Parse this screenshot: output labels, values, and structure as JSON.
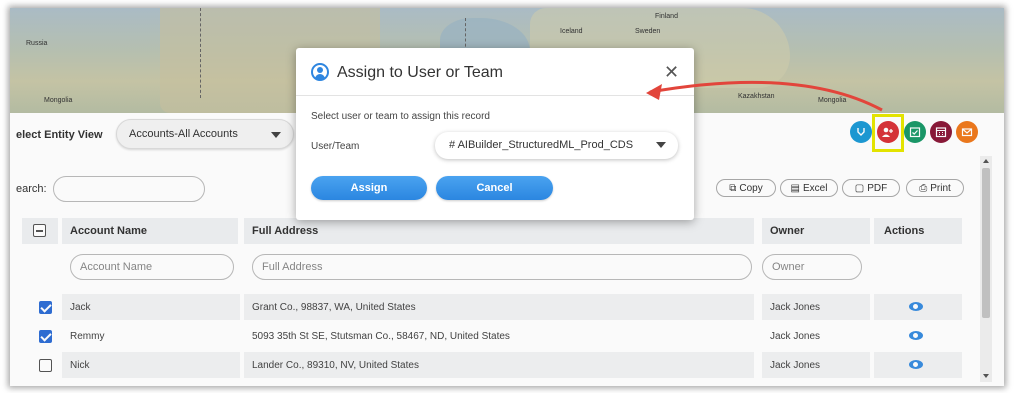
{
  "map": {
    "labels": [
      "Russia",
      "Mongolia",
      "Finland",
      "Iceland",
      "Sweden",
      "Kazakhstan",
      "Mongolia"
    ]
  },
  "toolbar": {
    "entity_view_label": "elect Entity View",
    "entity_view_value": "Accounts-All Accounts"
  },
  "icons": {
    "buttons": [
      {
        "name": "filter-icon",
        "color": "#1d9bd6"
      },
      {
        "name": "assign-user-icon",
        "color": "#d9343a"
      },
      {
        "name": "calendar-check-icon",
        "color": "#1b9a6a"
      },
      {
        "name": "calendar-icon",
        "color": "#8b1a3a"
      },
      {
        "name": "email-icon",
        "color": "#ef7a1d"
      }
    ],
    "highlight_color": "#e8e800",
    "arrow_color": "#e2453b"
  },
  "search": {
    "label": "earch:"
  },
  "export": {
    "copy": "Copy",
    "excel": "Excel",
    "pdf": "PDF",
    "print": "Print"
  },
  "table": {
    "headers": {
      "account_name": "Account Name",
      "full_address": "Full Address",
      "owner": "Owner",
      "actions": "Actions"
    },
    "filters": {
      "account_name": "Account Name",
      "full_address": "Full Address",
      "owner": "Owner"
    },
    "rows": [
      {
        "checked": true,
        "account_name": "Jack",
        "full_address": "Grant Co., 98837, WA, United States",
        "owner": "Jack Jones"
      },
      {
        "checked": true,
        "account_name": "Remmy",
        "full_address": "5093 35th St SE, Stutsman Co., 58467, ND, United States",
        "owner": "Jack Jones"
      },
      {
        "checked": false,
        "account_name": "Nick",
        "full_address": "Lander Co., 89310, NV, United States",
        "owner": "Jack Jones"
      }
    ]
  },
  "dialog": {
    "title": "Assign to User or Team",
    "subtitle": "Select user or team to assign this record",
    "user_team_label": "User/Team",
    "user_team_value": "# AIBuilder_StructuredML_Prod_CDS",
    "assign_label": "Assign",
    "cancel_label": "Cancel",
    "close_symbol": "✕",
    "accent_color": "#2f86e0"
  }
}
